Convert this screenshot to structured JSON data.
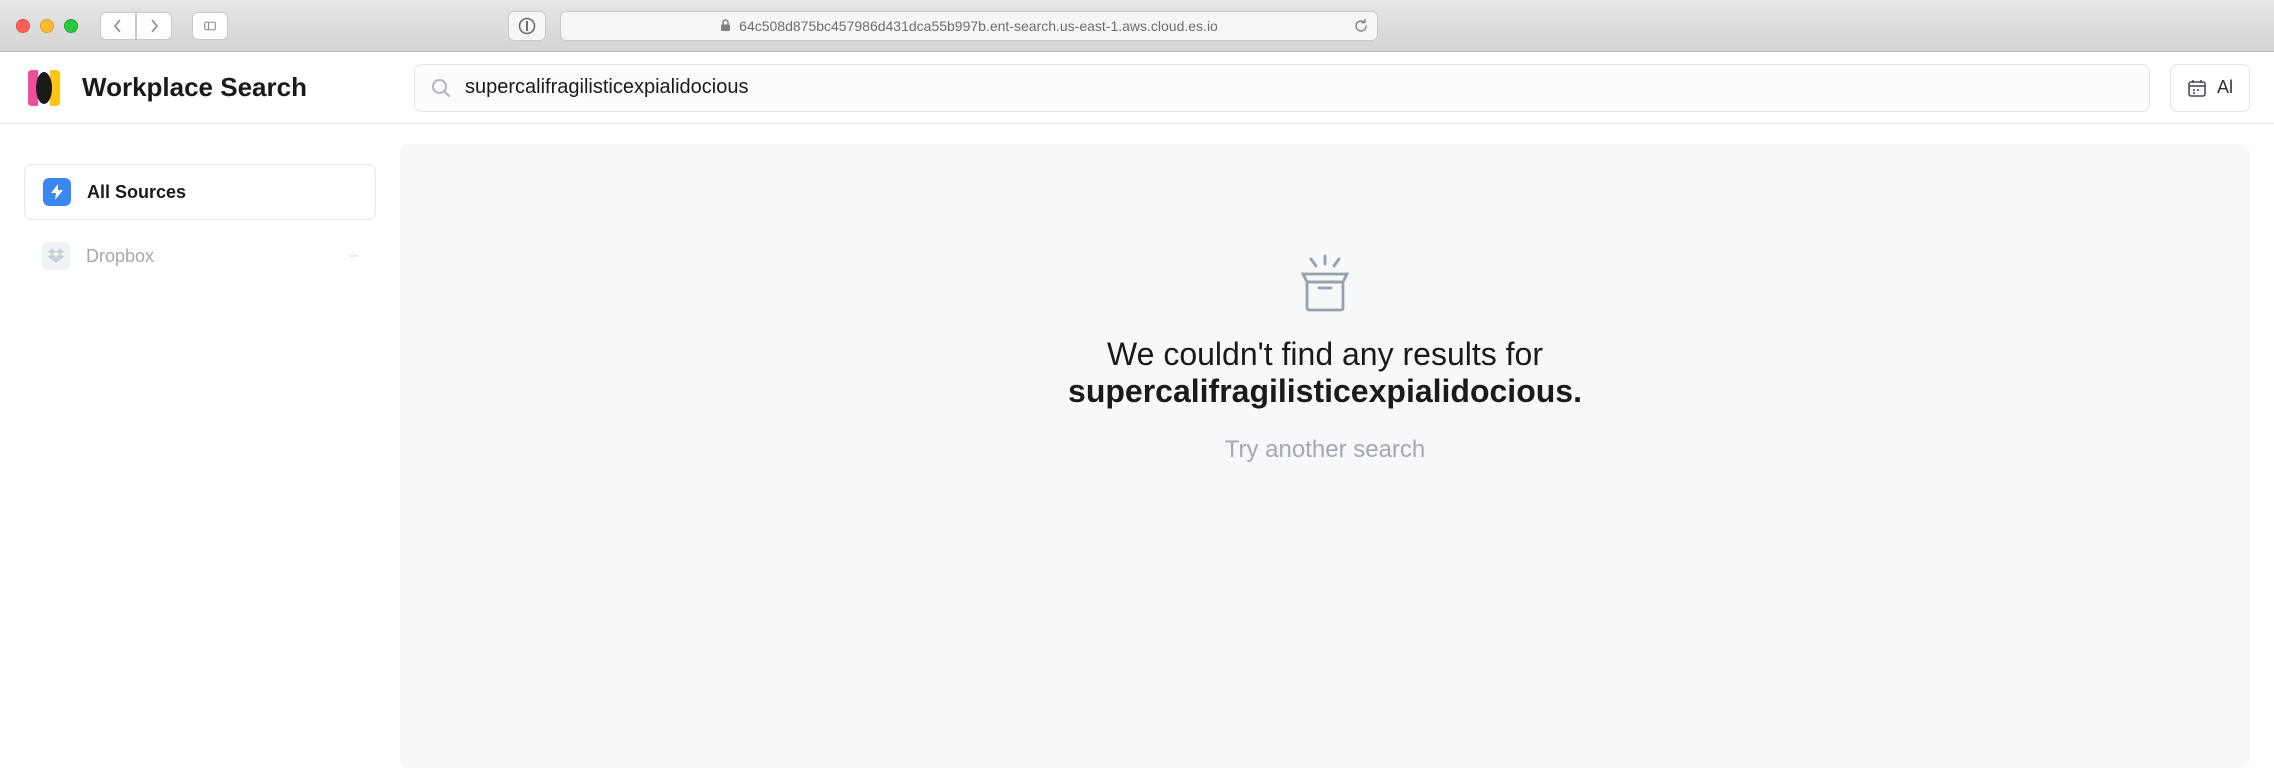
{
  "browser": {
    "url": "64c508d875bc457986d431dca55b997b.ent-search.us-east-1.aws.cloud.es.io"
  },
  "header": {
    "app_title": "Workplace Search",
    "search_value": "supercalifragilisticexpialidocious",
    "filter_label": "Al"
  },
  "sidebar": {
    "items": [
      {
        "label": "All Sources",
        "active": true
      },
      {
        "label": "Dropbox",
        "active": false
      }
    ]
  },
  "results": {
    "empty_prefix": "We couldn't find any results for",
    "query": "supercalifragilisticexpialidocious",
    "period": ".",
    "hint": "Try another search"
  }
}
